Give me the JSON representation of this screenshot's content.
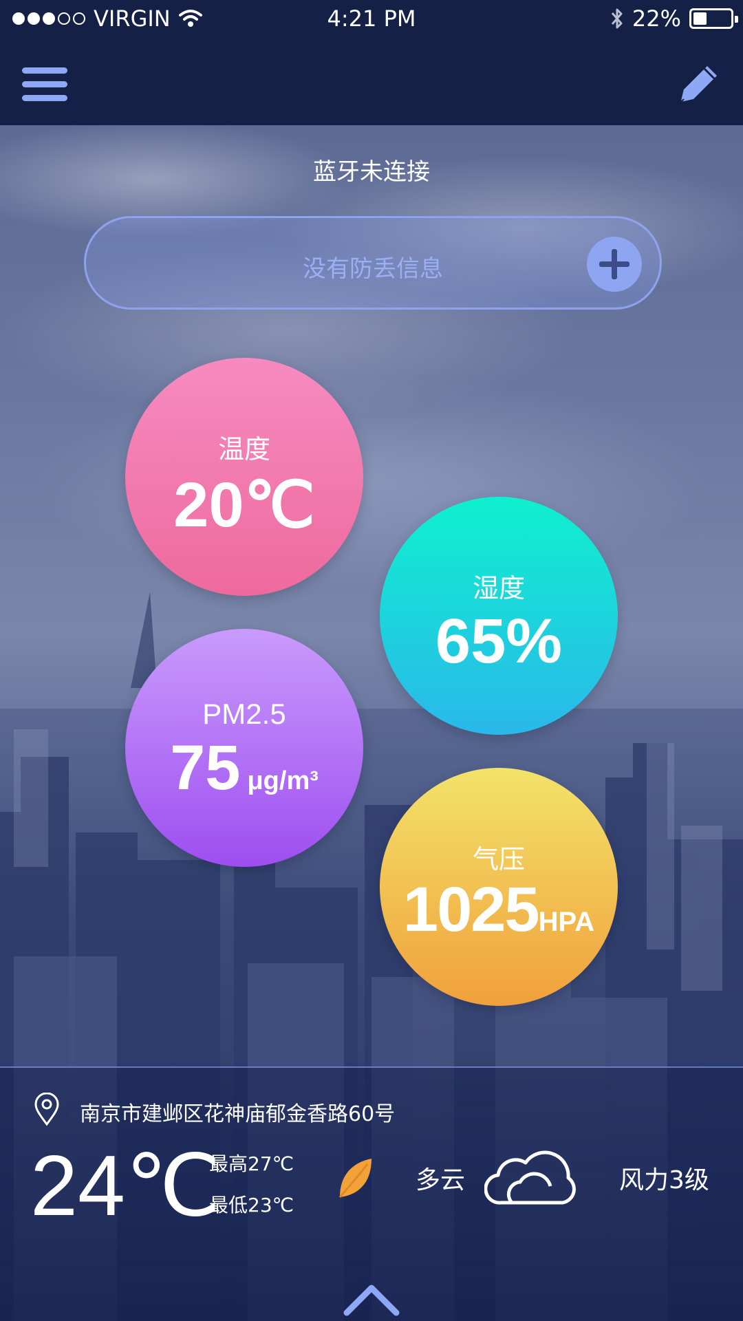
{
  "status_bar": {
    "carrier": "VIRGIN",
    "time": "4:21 PM",
    "battery": "22%",
    "battery_level": 0.22,
    "signal_bars": 3
  },
  "nav": {
    "menu_icon": "hamburger-menu-icon",
    "edit_icon": "pencil-icon"
  },
  "bluetooth_status": "蓝牙未连接",
  "anti_loss": {
    "placeholder": "没有防丢信息",
    "add_icon": "plus-icon"
  },
  "metrics": {
    "temperature": {
      "label": "温度",
      "value": "20℃"
    },
    "humidity": {
      "label": "湿度",
      "value": "65%"
    },
    "pm25": {
      "label": "PM2.5",
      "value": "75",
      "unit": "μg/m³"
    },
    "pressure": {
      "label": "气压",
      "value": "1025",
      "unit": "HPA"
    }
  },
  "weather": {
    "location": "南京市建邺区花神庙郁金香路60号",
    "current_temp": "24℃",
    "high": "最高27℃",
    "low": "最低23℃",
    "condition": "多云",
    "wind": "风力3级"
  },
  "colors": {
    "bar_bg": "#152046",
    "accent": "#8ea6f2",
    "temp_bubble": "#ee6a9d",
    "humidity_bubble": "#14d8d8",
    "pm_bubble": "#b073f6",
    "pressure_bubble": "#f2c550",
    "leaf": "#f3a23a"
  }
}
